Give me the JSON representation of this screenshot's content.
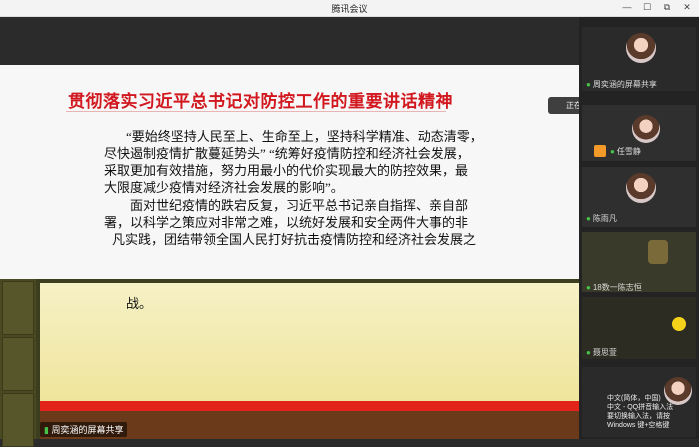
{
  "window": {
    "title": "腾讯会议",
    "controls": [
      "—",
      "☐",
      "⧉",
      "✕"
    ]
  },
  "slide": {
    "header": "贯彻落实习近平总书记对防控工作的重要讲话精神",
    "paragraph1_lines": [
      "“要始终坚持人民至上、生命至上，坚持科学精准、动态清零，",
      "尽快遏制疫情扩散蔓延势头” “统筹好疫情防控和经济社会发展，",
      "采取更加有效措施，努力用最小的代价实现最大的防控效果，最",
      "大限度减少疫情对经济社会发展的影响”。"
    ],
    "paragraph2_lines": [
      "面对世纪疫情的跌宕反复，习近平总书记亲自指挥、亲自部",
      "署，以科学之策应对非常之难，以统好发展和安全两件大事的非",
      "凡实践，团结带领全国人民打好抗击疫情防控和经济社会发展之",
      "战。"
    ]
  },
  "share_label": "周奕涵的屏幕共享",
  "speaking": "正在讲话: 周奕涵;",
  "participants": [
    {
      "name": "周奕涵的屏幕共享"
    },
    {
      "name": "任雪静"
    },
    {
      "name": "陈雨凡"
    },
    {
      "name": "18数一陈志恒"
    },
    {
      "name": "聂思萱"
    }
  ],
  "ime": {
    "lines": [
      "中文(简体，中国)",
      "中文 - QQ拼音输入法",
      "要切换输入法，请按",
      "Windows 键+空格键"
    ]
  }
}
